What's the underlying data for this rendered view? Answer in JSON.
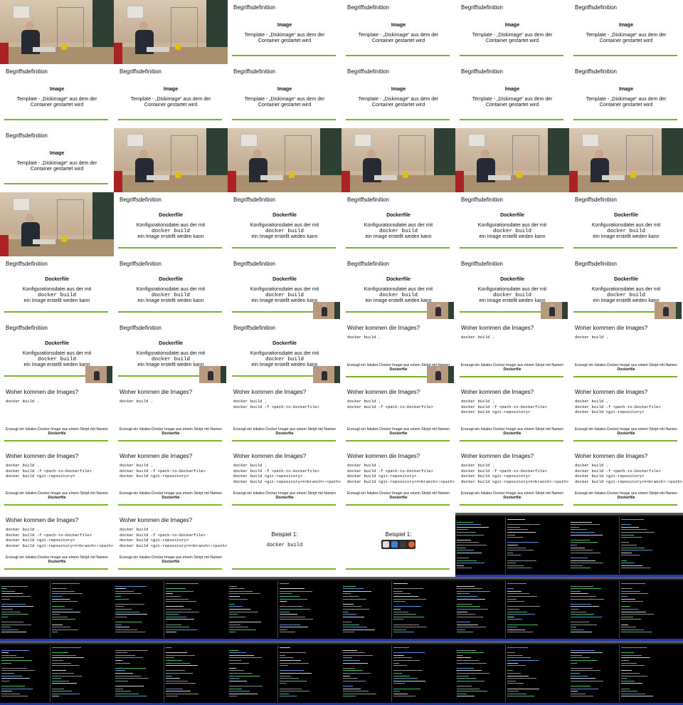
{
  "thumbnails": [
    {
      "kind": "video"
    },
    {
      "kind": "video"
    },
    {
      "kind": "image-slide",
      "title": "Begriffsdefinition",
      "heading": "Image",
      "text": "Template - „Diskimage“ aus dem der Container gestartet wird"
    },
    {
      "kind": "image-slide",
      "title": "Begriffsdefinition",
      "heading": "Image",
      "text": "Template - „Diskimage“ aus dem der Container gestartet wird"
    },
    {
      "kind": "image-slide",
      "title": "Begriffsdefinition",
      "heading": "Image",
      "text": "Template - „Diskimage“ aus dem der Container gestartet wird"
    },
    {
      "kind": "image-slide",
      "title": "Begriffsdefinition",
      "heading": "Image",
      "text": "Template - „Diskimage“ aus dem der Container gestartet wird"
    },
    {
      "kind": "image-slide",
      "title": "Begriffsdefinition",
      "heading": "Image",
      "text": "Template - „Diskimage“ aus dem der Container gestartet wird"
    },
    {
      "kind": "image-slide",
      "title": "Begriffsdefinition",
      "heading": "Image",
      "text": "Template - „Diskimage“ aus dem der Container gestartet wird"
    },
    {
      "kind": "image-slide",
      "title": "Begriffsdefinition",
      "heading": "Image",
      "text": "Template - „Diskimage“ aus dem der Container gestartet wird"
    },
    {
      "kind": "image-slide",
      "title": "Begriffsdefinition",
      "heading": "Image",
      "text": "Template - „Diskimage“ aus dem der Container gestartet wird"
    },
    {
      "kind": "image-slide",
      "title": "Begriffsdefinition",
      "heading": "Image",
      "text": "Template - „Diskimage“ aus dem der Container gestartet wird"
    },
    {
      "kind": "image-slide",
      "title": "Begriffsdefinition",
      "heading": "Image",
      "text": "Template - „Diskimage“ aus dem der Container gestartet wird"
    },
    {
      "kind": "image-slide",
      "title": "Begriffsdefinition",
      "heading": "Image",
      "text": "Template - „Diskimage“ aus dem der Container gestartet wird"
    },
    {
      "kind": "video"
    },
    {
      "kind": "video"
    },
    {
      "kind": "video"
    },
    {
      "kind": "video"
    },
    {
      "kind": "video"
    },
    {
      "kind": "video"
    },
    {
      "kind": "dockerfile-slide",
      "title": "Begriffsdefinition",
      "heading": "Dockerfile",
      "line1": "Konfigurationsdatei aus der mit",
      "cmd": "docker build",
      "line2": "ein Image erstellt weden kann"
    },
    {
      "kind": "dockerfile-slide",
      "title": "Begriffsdefinition",
      "heading": "Dockerfile",
      "line1": "Konfigurationsdatei aus der mit",
      "cmd": "docker build",
      "line2": "ein Image erstellt weden kann"
    },
    {
      "kind": "dockerfile-slide",
      "title": "Begriffsdefinition",
      "heading": "Dockerfile",
      "line1": "Konfigurationsdatei aus der mit",
      "cmd": "docker build",
      "line2": "ein Image erstellt weden kann"
    },
    {
      "kind": "dockerfile-slide",
      "title": "Begriffsdefinition",
      "heading": "Dockerfile",
      "line1": "Konfigurationsdatei aus der mit",
      "cmd": "docker build",
      "line2": "ein Image erstellt weden kann"
    },
    {
      "kind": "dockerfile-slide",
      "title": "Begriffsdefinition",
      "heading": "Dockerfile",
      "line1": "Konfigurationsdatei aus der mit",
      "cmd": "docker build",
      "line2": "ein Image erstellt weden kann"
    },
    {
      "kind": "dockerfile-slide",
      "title": "Begriffsdefinition",
      "heading": "Dockerfile",
      "line1": "Konfigurationsdatei aus der mit",
      "cmd": "docker build",
      "line2": "ein Image erstellt weden kann"
    },
    {
      "kind": "dockerfile-slide",
      "title": "Begriffsdefinition",
      "heading": "Dockerfile",
      "line1": "Konfigurationsdatei aus der mit",
      "cmd": "docker build",
      "line2": "ein Image erstellt weden kann"
    },
    {
      "kind": "dockerfile-slide",
      "title": "Begriffsdefinition",
      "heading": "Dockerfile",
      "line1": "Konfigurationsdatei aus der mit",
      "cmd": "docker build",
      "line2": "ein Image erstellt weden kann",
      "pip": true
    },
    {
      "kind": "dockerfile-slide",
      "title": "Begriffsdefinition",
      "heading": "Dockerfile",
      "line1": "Konfigurationsdatei aus der mit",
      "cmd": "docker build",
      "line2": "ein Image erstellt weden kann",
      "pip": true
    },
    {
      "kind": "dockerfile-slide",
      "title": "Begriffsdefinition",
      "heading": "Dockerfile",
      "line1": "Konfigurationsdatei aus der mit",
      "cmd": "docker build",
      "line2": "ein Image erstellt weden kann",
      "pip": true
    },
    {
      "kind": "dockerfile-slide",
      "title": "Begriffsdefinition",
      "heading": "Dockerfile",
      "line1": "Konfigurationsdatei aus der mit",
      "cmd": "docker build",
      "line2": "ein Image erstellt weden kann",
      "pip": true
    },
    {
      "kind": "dockerfile-slide",
      "title": "Begriffsdefinition",
      "heading": "Dockerfile",
      "line1": "Konfigurationsdatei aus der mit",
      "cmd": "docker build",
      "line2": "ein Image erstellt weden kann",
      "pip": true
    },
    {
      "kind": "dockerfile-slide",
      "title": "Begriffsdefinition",
      "heading": "Dockerfile",
      "line1": "Konfigurationsdatei aus der mit",
      "cmd": "docker build",
      "line2": "ein Image erstellt weden kann",
      "pip": true
    },
    {
      "kind": "dockerfile-slide",
      "title": "Begriffsdefinition",
      "heading": "Dockerfile",
      "line1": "Konfigurationsdatei aus der mit",
      "cmd": "docker build",
      "line2": "ein Image erstellt weden kann",
      "pip": true
    },
    {
      "kind": "code-slide",
      "title": "Woher kommen die Images?",
      "code": "docker build .",
      "foot": "Erzeugt ein lokales Docker Image aus einem Skript mit Namen",
      "footBold": "Dockerfile",
      "pip": true
    },
    {
      "kind": "code-slide",
      "title": "Woher kommen die Images?",
      "code": "docker build .",
      "foot": "Erzeugt ein lokales Docker Image aus einem Skript mit Namen",
      "footBold": "Dockerfile"
    },
    {
      "kind": "code-slide",
      "title": "Woher kommen die Images?",
      "code": "docker build .",
      "foot": "Erzeugt ein lokales Docker Image aus einem Skript mit Namen",
      "footBold": "Dockerfile"
    },
    {
      "kind": "code-slide",
      "title": "Woher kommen die Images?",
      "code": "docker build .",
      "foot": "Erzeugt ein lokales Docker Image aus einem Skript mit Namen",
      "footBold": "Dockerfile"
    },
    {
      "kind": "code-slide",
      "title": "Woher kommen die Images?",
      "code": "docker build .",
      "foot": "Erzeugt ein lokales Docker Image aus einem Skript mit Namen",
      "footBold": "Dockerfile"
    },
    {
      "kind": "code-slide",
      "title": "Woher kommen die Images?",
      "code": "docker build .\ndocker build -f <path-to-Dockerfile>",
      "foot": "Erzeugt ein lokales Docker Image aus einem Skript mit Namen",
      "footBold": "Dockerfile"
    },
    {
      "kind": "code-slide",
      "title": "Woher kommen die Images?",
      "code": "docker build .\ndocker build -f <path-to-Dockerfile>",
      "foot": "Erzeugt ein lokales Docker Image aus einem Skript mit Namen",
      "footBold": "Dockerfile"
    },
    {
      "kind": "code-slide",
      "title": "Woher kommen die Images?",
      "code": "docker build .\ndocker build -f <path-to-Dockerfile>\ndocker build <git-repository>",
      "foot": "Erzeugt ein lokales Docker Image aus einem Skript mit Namen",
      "footBold": "Dockerfile"
    },
    {
      "kind": "code-slide",
      "title": "Woher kommen die Images?",
      "code": "docker build .\ndocker build -f <path-to-Dockerfile>\ndocker build <git-repository>",
      "foot": "Erzeugt ein lokales Docker Image aus einem Skript mit Namen",
      "footBold": "Dockerfile"
    },
    {
      "kind": "code-slide",
      "title": "Woher kommen die Images?",
      "code": "docker build .\ndocker build -f <path-to-Dockerfile>\ndocker build <git-repository>",
      "foot": "Erzeugt ein lokales Docker Image aus einem Skript mit Namen",
      "footBold": "Dockerfile"
    },
    {
      "kind": "code-slide",
      "title": "Woher kommen die Images?",
      "code": "docker build .\ndocker build -f <path-to-Dockerfile>\ndocker build <git-repository>",
      "foot": "Erzeugt ein lokales Docker Image aus einem Skript mit Namen",
      "footBold": "Dockerfile"
    },
    {
      "kind": "code-slide",
      "title": "Woher kommen die Images?",
      "code": "docker build .\ndocker build -f <path-to-Dockerfile>\ndocker build <git-repository>\ndocker build <git-repository>#<branch>:<path>",
      "foot": "Erzeugt ein lokales Docker Image aus einem Skript mit Namen",
      "footBold": "Dockerfile"
    },
    {
      "kind": "code-slide",
      "title": "Woher kommen die Images?",
      "code": "docker build .\ndocker build -f <path-to-Dockerfile>\ndocker build <git-repository>\ndocker build <git-repository>#<branch>:<path>",
      "foot": "Erzeugt ein lokales Docker Image aus einem Skript mit Namen",
      "footBold": "Dockerfile"
    },
    {
      "kind": "code-slide",
      "title": "Woher kommen die Images?",
      "code": "docker build .\ndocker build -f <path-to-Dockerfile>\ndocker build <git-repository>\ndocker build <git-repository>#<branch>:<path>",
      "foot": "Erzeugt ein lokales Docker Image aus einem Skript mit Namen",
      "footBold": "Dockerfile"
    },
    {
      "kind": "code-slide",
      "title": "Woher kommen die Images?",
      "code": "docker build .\ndocker build -f <path-to-Dockerfile>\ndocker build <git-repository>\ndocker build <git-repository>#<branch>:<path>",
      "foot": "Erzeugt ein lokales Docker Image aus einem Skript mit Namen",
      "footBold": "Dockerfile"
    },
    {
      "kind": "code-slide",
      "title": "Woher kommen die Images?",
      "code": "docker build .\ndocker build -f <path-to-Dockerfile>\ndocker build <git-repository>\ndocker build <git-repository>#<branch>:<path>",
      "foot": "Erzeugt ein lokales Docker Image aus einem Skript mit Namen",
      "footBold": "Dockerfile"
    },
    {
      "kind": "code-slide",
      "title": "Woher kommen die Images?",
      "code": "docker build .\ndocker build -f <path-to-Dockerfile>\ndocker build <git-repository>\ndocker build <git-repository>#<branch>:<path>",
      "foot": "Erzeugt ein lokales Docker Image aus einem Skript mit Namen",
      "footBold": "Dockerfile"
    },
    {
      "kind": "example-slide",
      "title": "Beispiel 1:",
      "code": "docker build"
    },
    {
      "kind": "example-dock-slide",
      "title": "Beispiel 1:"
    },
    {
      "kind": "terminal"
    },
    {
      "kind": "terminal"
    },
    {
      "kind": "terminal"
    },
    {
      "kind": "terminal"
    },
    {
      "kind": "terminal"
    },
    {
      "kind": "terminal"
    },
    {
      "kind": "terminal"
    },
    {
      "kind": "terminal"
    },
    {
      "kind": "terminal"
    },
    {
      "kind": "terminal"
    },
    {
      "kind": "terminal"
    },
    {
      "kind": "terminal"
    },
    {
      "kind": "terminal"
    },
    {
      "kind": "terminal"
    }
  ],
  "colors": {
    "accent_green": "#7cb32a",
    "terminal_bg": "#000000",
    "terminal_status": "#2238b8"
  },
  "icons": {
    "dock": [
      "finder-icon",
      "files-icon",
      "terminal-icon",
      "firefox-icon"
    ]
  }
}
